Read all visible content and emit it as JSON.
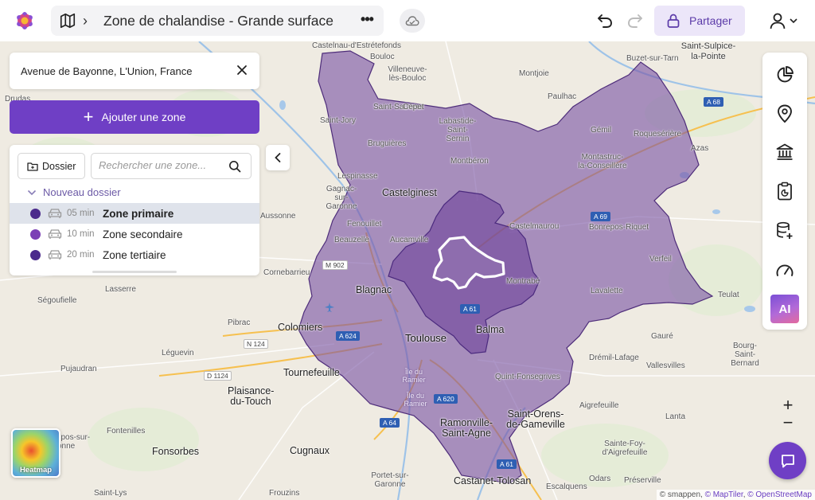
{
  "header": {
    "title": "Zone de chalandise - Grande surface",
    "more_label": "•••",
    "share_label": "Partager"
  },
  "search": {
    "address": "Avenue de Bayonne, L'Union, France",
    "placeholder": "Rechercher une zone..."
  },
  "panel": {
    "add_zone_label": "Ajouter une zone",
    "folder_button_label": "Dossier",
    "folder_name": "Nouveau dossier",
    "zones": [
      {
        "time": "05 min",
        "name": "Zone primaire",
        "color": "#4b2a8c"
      },
      {
        "time": "10 min",
        "name": "Zone secondaire",
        "color": "#7b3fb5"
      },
      {
        "time": "20 min",
        "name": "Zone tertiaire",
        "color": "#4b2a8c"
      }
    ]
  },
  "toolbar": {
    "ai_label": "AI",
    "icons": [
      "pie-chart-icon",
      "location-pin-icon",
      "institution-icon",
      "report-icon",
      "database-add-icon",
      "speedometer-icon"
    ]
  },
  "controls": {
    "zoom_in": "+",
    "zoom_out": "−",
    "heatmap_label": "Heatmap"
  },
  "colors": {
    "accent": "#6f3fc5",
    "zone_outer": "#7a55a5",
    "zone_inner": "#6a3c98"
  },
  "map": {
    "attribution_prefix": "© smappen, ",
    "attribution_maptiler": "© MapTiler",
    "attribution_osm": "© OpenStreetMap",
    "places": [
      "Castelnau-d'Estrétefonds",
      "Bouloc",
      "Villeneuve-lès-Bouloc",
      "Montjoie",
      "Saint-Sulpice-la-Pointe",
      "Buzet-sur-Tarn",
      "Drudas",
      "Saint-Jory",
      "Saint-Sauveur",
      "Cépet",
      "Paulhac",
      "Labastide-Saint-Sernin",
      "Bruguières",
      "Gémil",
      "Roquesérière",
      "Azas",
      "Montbéron",
      "Montastruc-la-Conseillère",
      "Lespinasse",
      "Gagnac-sur-Garonne",
      "Castelginest",
      "Aussonne",
      "Fenouillet",
      "Castelmaurou",
      "Bonrepos-Riquet",
      "Beauzelle",
      "Aucamville",
      "Verfeil",
      "Cornebarrieu",
      "Blagnac",
      "Montrabé",
      "Lavalette",
      "Ségoufielle",
      "Lasserre",
      "Teulat",
      "Colomiers",
      "Pibrac",
      "Balma",
      "Toulouse",
      "Gauré",
      "Léguevin",
      "Bourg-Saint-Bernard",
      "Pujaudran",
      "Drémil-Lafage",
      "Vallesvilles",
      "Tournefeuille",
      "Quint-Fonsegrives",
      "Plaisance-du-Touch",
      "Île du Ramier",
      "Île du Ramier",
      "Aigrefeuille",
      "Fontenilles",
      "Ramonville-Saint-Agne",
      "Saint-Orens-de-Gameville",
      "Lanta",
      "Fonsorbes",
      "Cugnaux",
      "Sainte-Foy-d'Aigrefeuille",
      "Portet-sur-Garonne",
      "Odars",
      "Castanet-Tolosan",
      "Préserville",
      "Saint-Lys",
      "Frouzins",
      "Escalquens",
      "nrepos-sur-ssonne"
    ],
    "roads": [
      "A 68",
      "A 69",
      "M 902",
      "A 61",
      "A 624",
      "N 124",
      "D 1124",
      "A 620",
      "A 64",
      "A 61"
    ]
  }
}
